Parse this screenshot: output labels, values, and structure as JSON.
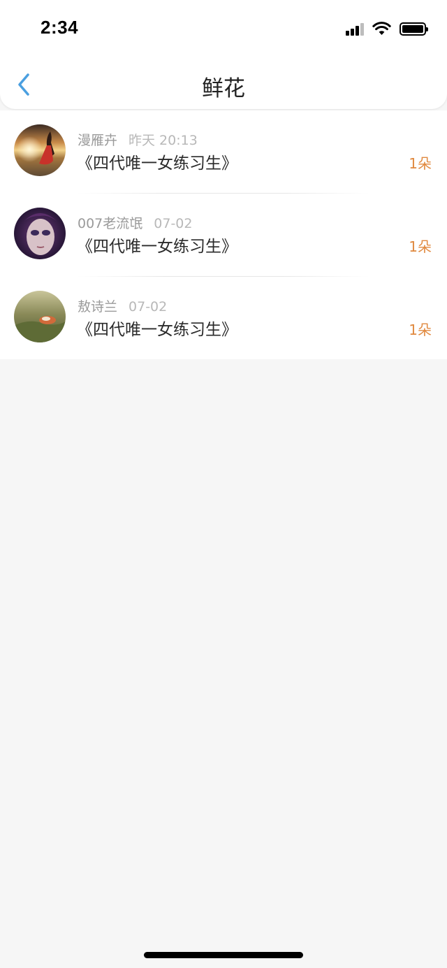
{
  "status_bar": {
    "time": "2:34"
  },
  "header": {
    "title": "鲜花"
  },
  "items": [
    {
      "user": "漫雁卉",
      "time": "昨天 20:13",
      "book": "《四代唯一女练习生》",
      "count": "1朵"
    },
    {
      "user": "007老流氓",
      "time": "07-02",
      "book": "《四代唯一女练习生》",
      "count": "1朵"
    },
    {
      "user": "敖诗兰",
      "time": "07-02",
      "book": "《四代唯一女练习生》",
      "count": "1朵"
    }
  ],
  "colors": {
    "accent_back": "#4a9fe0",
    "count": "#e0893f",
    "background": "#f6f6f6"
  },
  "icons": {
    "back": "chevron-left-icon",
    "signal": "cellular-signal-icon",
    "wifi": "wifi-icon",
    "battery": "battery-icon"
  }
}
